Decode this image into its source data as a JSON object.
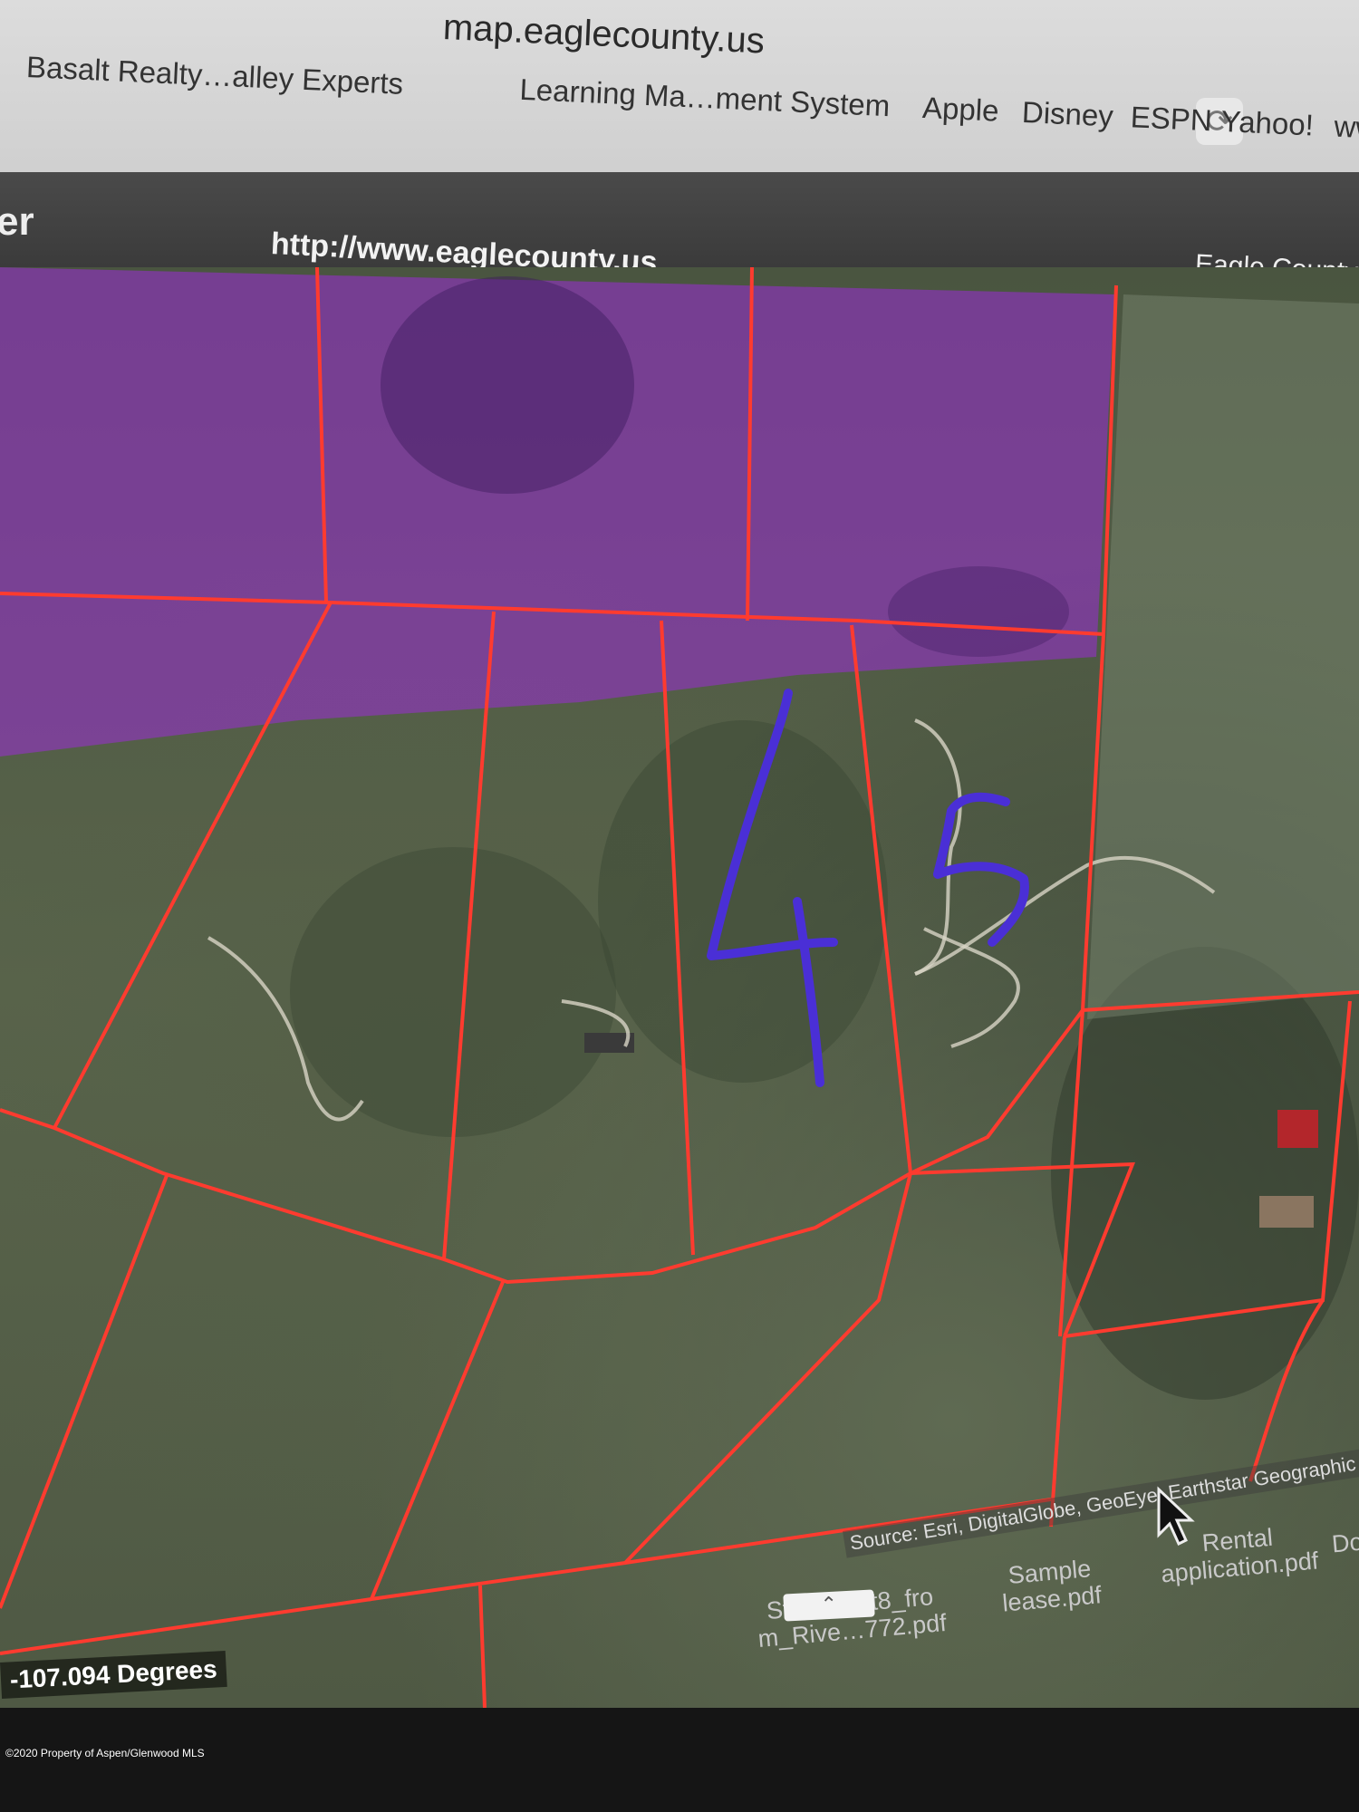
{
  "browser": {
    "address": "map.eaglecounty.us",
    "bookmarks": [
      "Basalt Realty…alley Experts",
      "Learning Ma…ment System",
      "Apple",
      "Disney",
      "ESPN",
      "Yahoo!",
      "ww"
    ]
  },
  "site_header": {
    "logo_fragment": "er",
    "url": "http://www.eaglecounty.us",
    "name": "Eagle County G"
  },
  "map": {
    "handwritten_labels": [
      "4",
      "5"
    ],
    "attribution": "Source: Esri, DigitalGlobe, GeoEye, Earthstar Geographic",
    "coordinates": "-107.094 Degrees",
    "colors": {
      "parcel_lines": "#ff3b2f",
      "highlight_zone": "#9b2bd6",
      "handwriting": "#4a2fd6"
    }
  },
  "desktop_files": [
    "Statement8_fro\nm_Rive…772.pdf",
    "Sample\nlease.pdf",
    "Rental\napplication.pdf",
    "Do"
  ],
  "copyright": "©2020 Property of Aspen/Glenwood MLS"
}
